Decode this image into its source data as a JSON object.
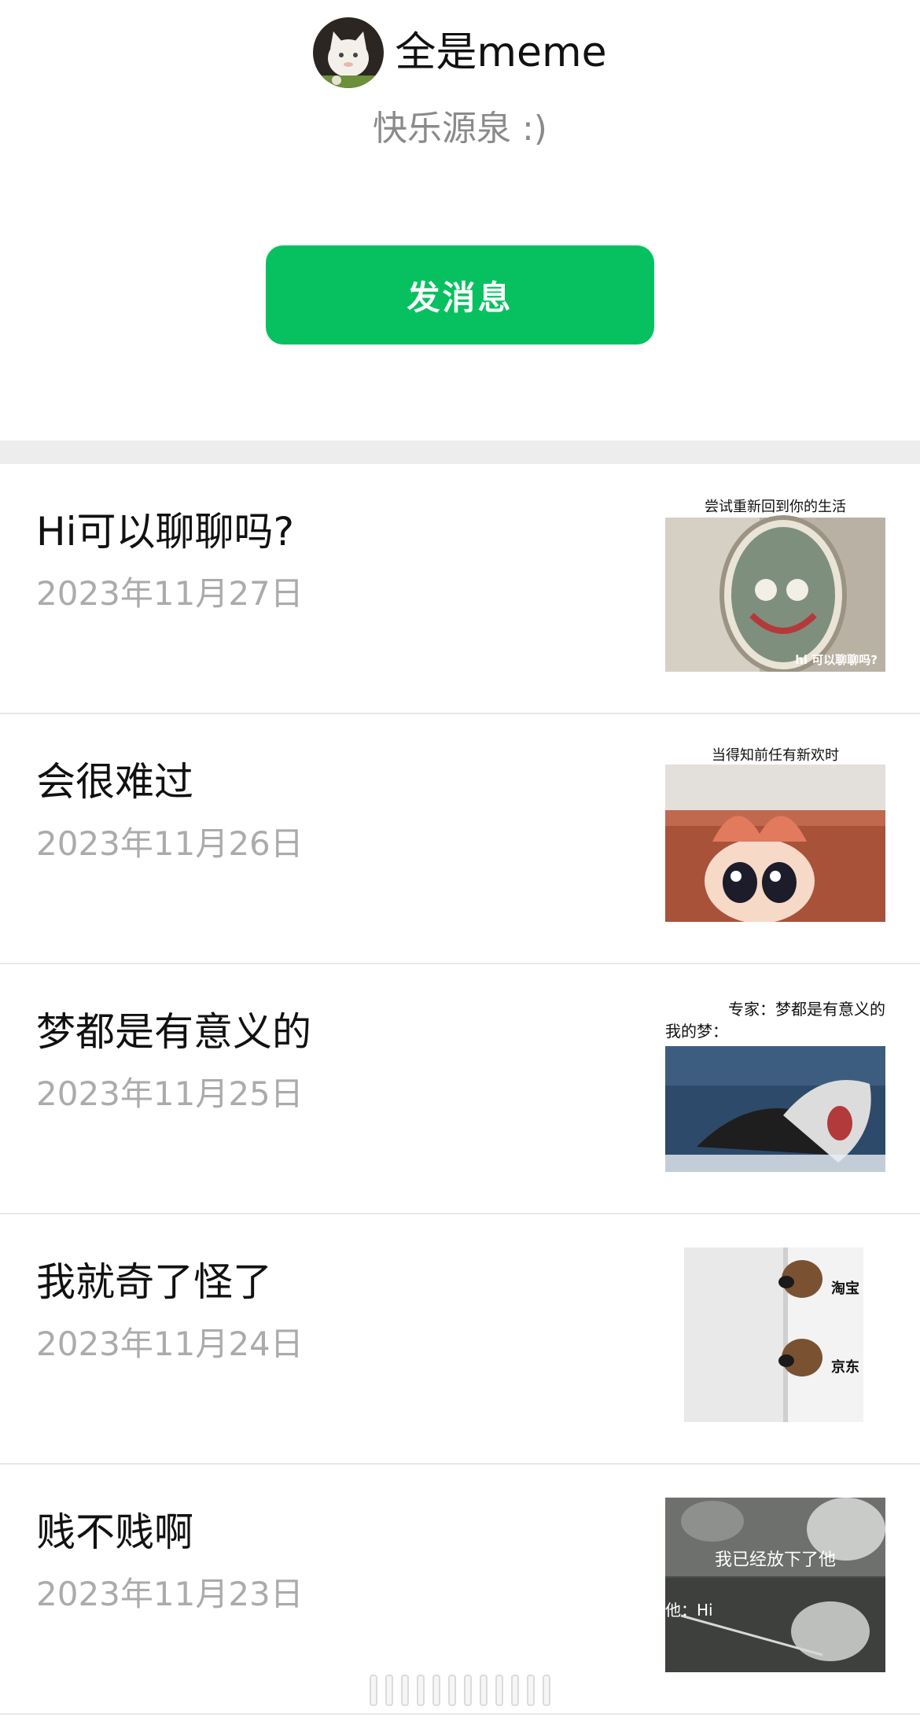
{
  "header": {
    "account_name": "全是meme",
    "signature": "快乐源泉 :)",
    "send_message_label": "发消息"
  },
  "articles": [
    {
      "title": "Hi可以聊聊吗?",
      "date": "2023年11月27日",
      "thumb_caption_top": "尝试重新回到你的生活",
      "thumb_caption_bottom": "hi 可以聊聊吗?"
    },
    {
      "title": "会很难过",
      "date": "2023年11月26日",
      "thumb_caption_top": "当得知前任有新欢时"
    },
    {
      "title": "梦都是有意义的",
      "date": "2023年11月25日",
      "thumb_caption_top": "专家：梦都是有意义的",
      "thumb_caption_second": "我的梦："
    },
    {
      "title": "我就奇了怪了",
      "date": "2023年11月24日",
      "thumb_label_1": "淘宝",
      "thumb_label_2": "京东"
    },
    {
      "title": "贱不贱啊",
      "date": "2023年11月23日",
      "thumb_caption_top": "我已经放下了他",
      "thumb_caption_bottom": "他：Hi"
    }
  ],
  "colors": {
    "accent_green": "#07c160",
    "section_gap": "#ededed",
    "date_gray": "#ababab"
  }
}
